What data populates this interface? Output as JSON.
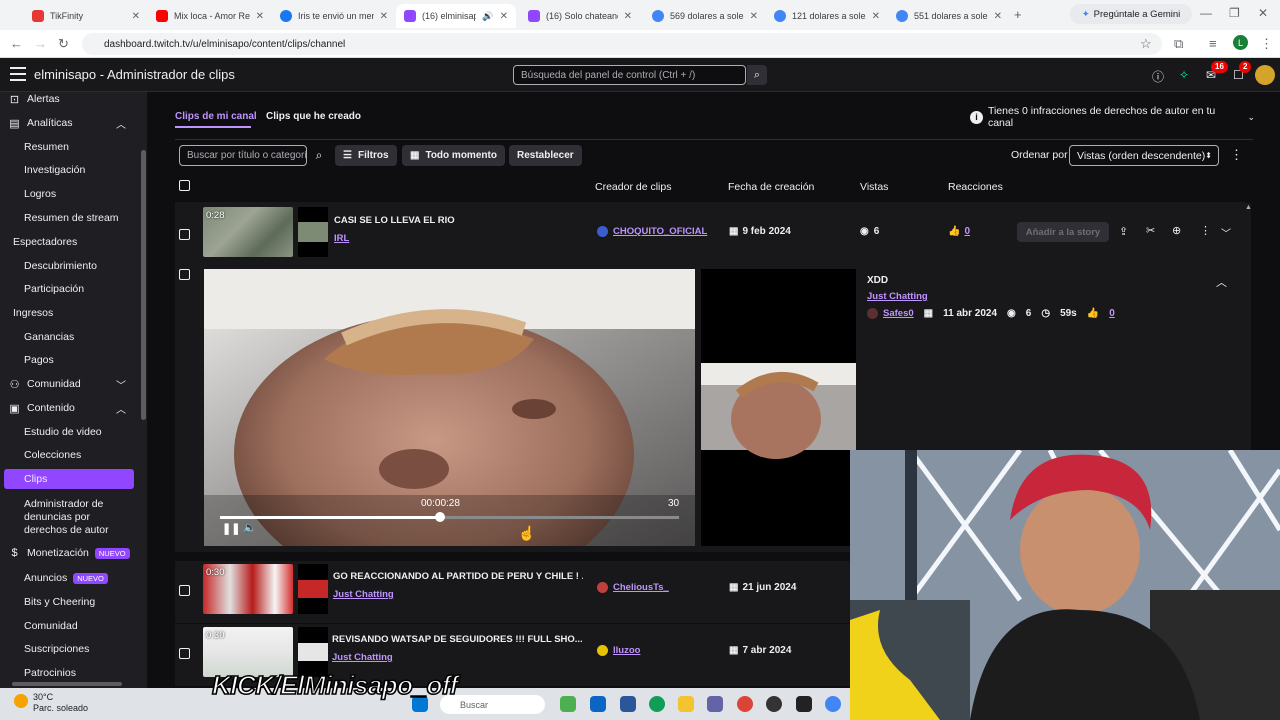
{
  "browser": {
    "tabs": [
      {
        "title": "TikFinity",
        "color": "#e53935"
      },
      {
        "title": "Mix loca - Amor Rebe",
        "color": "#ff0000"
      },
      {
        "title": "Iris te envió un mens",
        "color": "#1877f2"
      },
      {
        "title": "(16) elminisapo",
        "color": "#9147ff"
      },
      {
        "title": "(16) Solo chateando",
        "color": "#9147ff"
      },
      {
        "title": "569 dolares a soles",
        "color": "#4285f4"
      },
      {
        "title": "121 dolares a soles",
        "color": "#4285f4"
      },
      {
        "title": "551 dolares a soles",
        "color": "#4285f4"
      }
    ],
    "gemini": "Pregúntale a Gemini",
    "url": "dashboard.twitch.tv/u/elminisapo/content/clips/channel",
    "profile_initial": "L"
  },
  "topbar": {
    "title": "elminisapo - Administrador de clips",
    "search_placeholder": "Búsqueda del panel de control (Ctrl + /)",
    "inbox_badge": "16",
    "notif_badge": "2"
  },
  "sidebar": {
    "alertas": "Alertas",
    "analiticas": "Analíticas",
    "resumen": "Resumen",
    "investigacion": "Investigación",
    "logros": "Logros",
    "resumen_stream": "Resumen de stream",
    "espectadores": "Espectadores",
    "descubrimiento": "Descubrimiento",
    "participacion": "Participación",
    "ingresos": "Ingresos",
    "ganancias": "Ganancias",
    "pagos": "Pagos",
    "comunidad": "Comunidad",
    "contenido": "Contenido",
    "estudio": "Estudio de video",
    "colecciones": "Colecciones",
    "clips": "Clips",
    "admin1": "Administrador de",
    "admin2": "denuncias por",
    "admin3": "derechos de autor",
    "monetizacion": "Monetización",
    "nuevo": "NUEVO",
    "anuncios": "Anuncios",
    "bits": "Bits y Cheering",
    "comunidad2": "Comunidad",
    "suscripciones": "Suscripciones",
    "patrocinios": "Patrocinios"
  },
  "main": {
    "tab_channel": "Clips de mi canal",
    "tab_mine": "Clips que he creado",
    "infractions": "Tienes 0 infracciones de derechos de autor en tu canal",
    "filter_placeholder": "Buscar por título o categoría",
    "filters": "Filtros",
    "all_time": "Todo momento",
    "reset": "Restablecer",
    "order_by": "Ordenar por",
    "order_value": "Vistas (orden descendente)",
    "headers": {
      "creator": "Creador de clips",
      "date": "Fecha de creación",
      "views": "Vistas",
      "reactions": "Reacciones"
    },
    "rows": [
      {
        "duration": "0:28",
        "title": "CASI SE LO LLEVA EL RIO",
        "category": "IRL",
        "creator": "CHOQUITO_OFICIAL",
        "date": "9 feb 2024",
        "views": "6",
        "likes": "0"
      },
      {
        "duration": "0:30",
        "title": "GO REACCIONANDO AL PARTIDO DE PERU Y CHILE ! ...",
        "category": "Just Chatting",
        "creator": "CheliousTs_",
        "date": "21 jun 2024"
      },
      {
        "duration": "0:30",
        "title": "REVISANDO WATSAP DE SEGUIDORES !!! FULL SHO...",
        "category": "Just Chatting",
        "creator": "lluzoo",
        "date": "7 abr 2024"
      }
    ],
    "add_story": "Añadir a la story",
    "expanded": {
      "title": "XDD",
      "category": "Just Chatting",
      "creator": "Safes0",
      "date": "11 abr 2024",
      "views": "6",
      "duration": "59s",
      "likes": "0",
      "timecode": "00:00:28",
      "end": "30",
      "progress_fraction": 0.48
    }
  },
  "overlay": {
    "kick_text": "KICK/ElMinisapo_off"
  },
  "taskbar": {
    "temp": "30°C",
    "weather": "Parc. soleado",
    "search": "Buscar"
  },
  "colors": {
    "twitch_purple": "#9147ff",
    "link_purple": "#bf94ff",
    "bg": "#0e0e10"
  }
}
